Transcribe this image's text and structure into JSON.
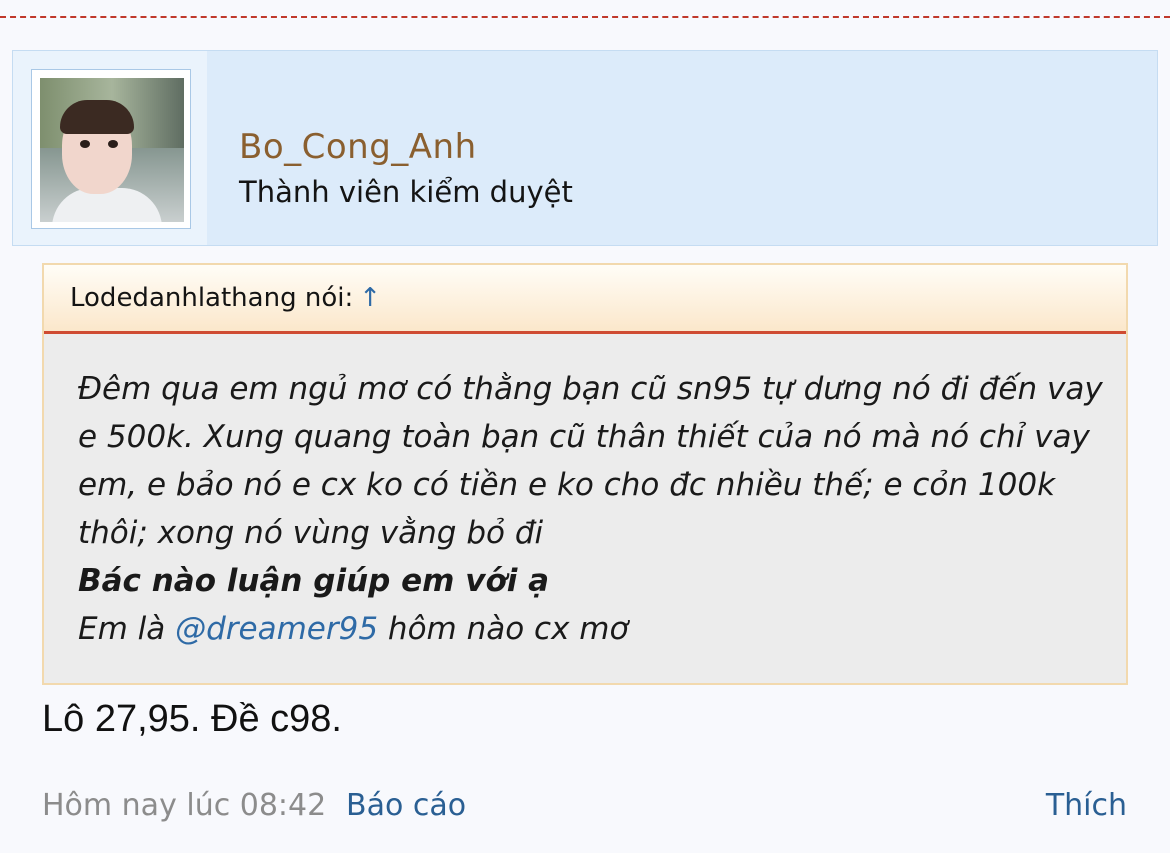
{
  "user": {
    "name": "Bo_Cong_Anh",
    "title": "Thành viên kiểm duyệt"
  },
  "quote": {
    "author_label": "Lodedanhlathang nói:",
    "arrow_icon": "up-arrow-icon",
    "arrow_glyph": "↑",
    "paragraph1": "Đêm qua em ngủ mơ có thằng bạn cũ sn95 tự dưng nó đi đến vay e 500k. Xung quang toàn bạn cũ thân thiết của nó mà nó chỉ vay em, e bảo nó e cx ko có tiền e ko cho đc nhiều thế; e cỏn 100k thôi; xong nó vùng vằng bỏ đi",
    "bold_line": "Bác nào luận giúp em với ạ",
    "mention_prefix": "Em là",
    "mention": "@dreamer95",
    "mention_suffix": "hôm nào cx mơ"
  },
  "post": {
    "text": "Lô 27,95. Đề c98."
  },
  "footer": {
    "timestamp": "Hôm nay lúc 08:42",
    "report_label": "Báo cáo",
    "like_label": "Thích"
  },
  "colors": {
    "username": "#8a5f2f",
    "link": "#2a5f93",
    "quote_border": "#f2d9ae",
    "quote_rule": "#cf4b32",
    "user_bar_bg": "#dcebfa"
  }
}
